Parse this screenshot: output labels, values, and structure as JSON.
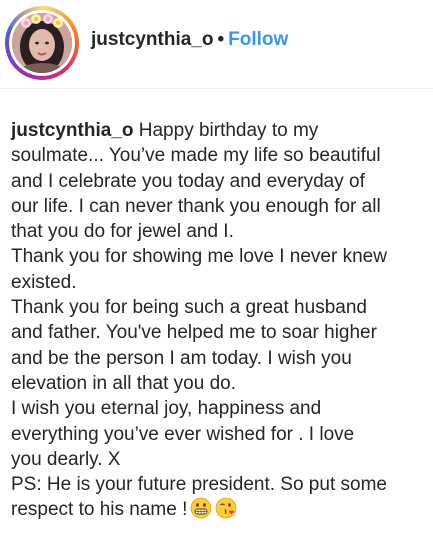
{
  "header": {
    "username": "justcynthia_o",
    "separator": "•",
    "follow_label": "Follow"
  },
  "caption": {
    "username": "justcynthia_o",
    "lines": [
      "Happy birthday to my",
      "soulmate... You’ve made my life so beautiful",
      "and I celebrate you today and everyday of",
      "our life. I can never thank you enough for all",
      "that you do for jewel and I.",
      "Thank you for showing me love I never knew",
      "existed.",
      "Thank you for being such a great husband",
      "and father. You've helped me to soar higher",
      "and be the person I am today. I wish you",
      "elevation in all that you do.",
      "I wish you eternal joy, happiness and",
      "everything you’ve ever wished for . I love",
      "you dearly. X",
      "PS: He is your future president. So put some",
      "respect to his name !"
    ],
    "emojis": [
      "grimacing-face-emoji",
      "face-blowing-kiss-emoji"
    ]
  }
}
